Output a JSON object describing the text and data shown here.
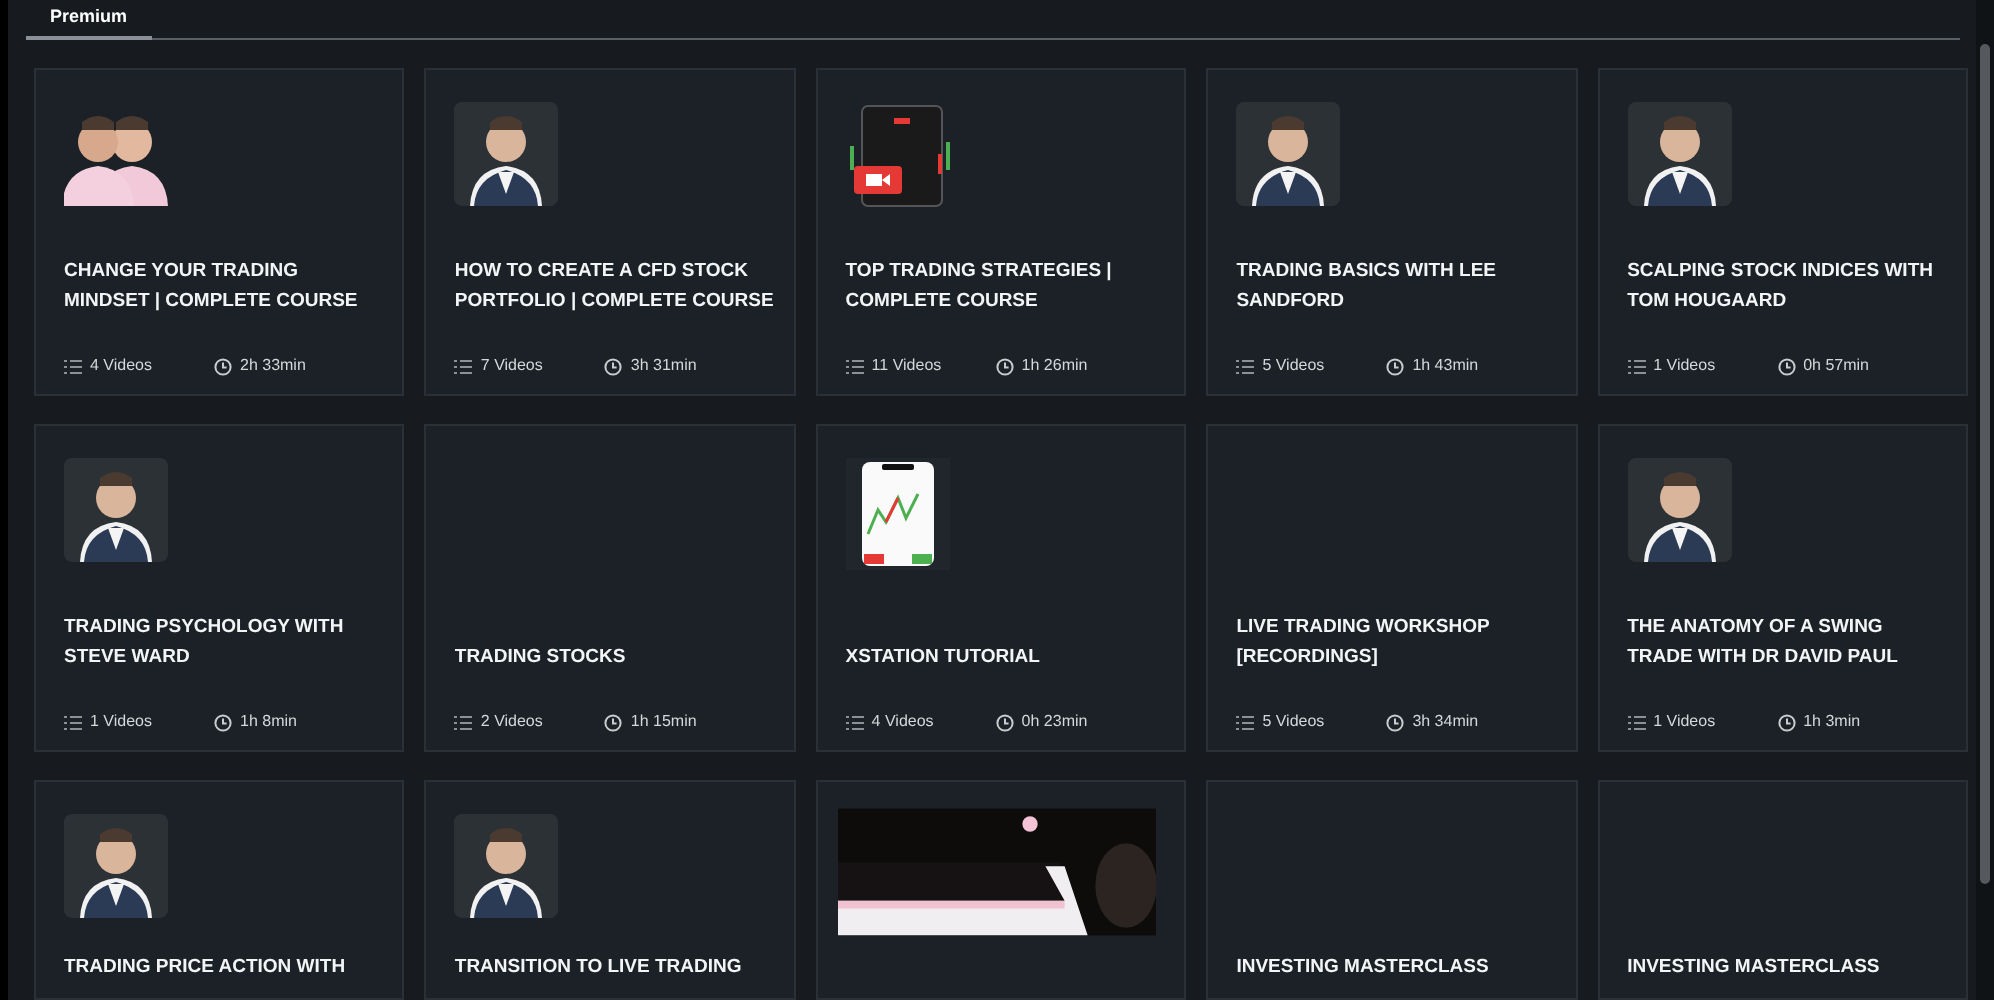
{
  "tabs": [
    {
      "label": "Premium",
      "selected": true
    }
  ],
  "cards": [
    {
      "title": "CHANGE YOUR TRADING MINDSET | COMPLETE COURSE",
      "videos": "4 Videos",
      "duration": "2h 33min",
      "kind": "pair"
    },
    {
      "title": "HOW TO CREATE A CFD STOCK PORTFOLIO | COMPLETE COURSE",
      "videos": "7 Videos",
      "duration": "3h 31min",
      "kind": "portrait"
    },
    {
      "title": "TOP TRADING STRATEGIES | COMPLETE COURSE",
      "videos": "11 Videos",
      "duration": "1h 26min",
      "kind": "guide"
    },
    {
      "title": "TRADING BASICS WITH LEE SANDFORD",
      "videos": "5 Videos",
      "duration": "1h 43min",
      "kind": "portrait"
    },
    {
      "title": "SCALPING STOCK INDICES WITH TOM HOUGAARD",
      "videos": "1 Videos",
      "duration": "0h 57min",
      "kind": "portrait"
    },
    {
      "title": "TRADING PSYCHOLOGY WITH STEVE WARD",
      "videos": "1 Videos",
      "duration": "1h 8min",
      "kind": "portrait"
    },
    {
      "title": "TRADING STOCKS",
      "videos": "2 Videos",
      "duration": "1h 15min"
    },
    {
      "title": "XSTATION TUTORIAL",
      "videos": "4 Videos",
      "duration": "0h 23min",
      "kind": "phone"
    },
    {
      "title": "LIVE TRADING WORKSHOP [RECORDINGS]",
      "videos": "5 Videos",
      "duration": "3h 34min"
    },
    {
      "title": "THE ANATOMY OF A SWING TRADE WITH DR DAVID PAUL",
      "videos": "1 Videos",
      "duration": "1h 3min",
      "kind": "portrait"
    },
    {
      "title": "TRADING PRICE ACTION WITH",
      "kind": "portrait"
    },
    {
      "title": "TRANSITION TO LIVE TRADING",
      "kind": "portrait"
    },
    {
      "kind": "banner"
    },
    {
      "title": "INVESTING MASTERCLASS"
    },
    {
      "title": "INVESTING MASTERCLASS"
    }
  ]
}
